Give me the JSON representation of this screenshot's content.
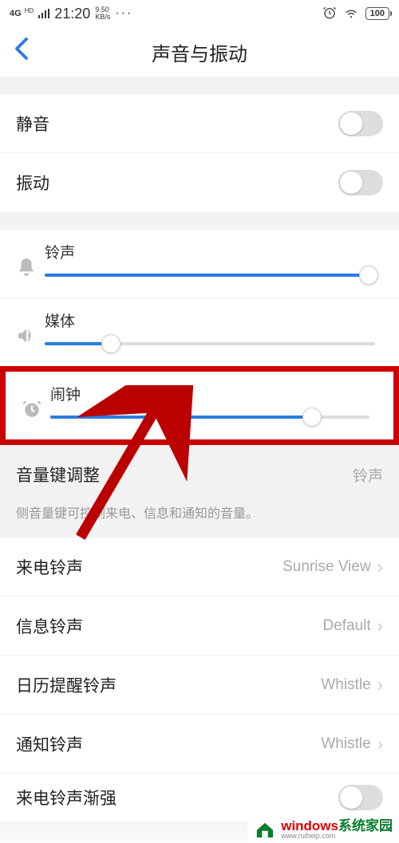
{
  "status": {
    "network": "4G",
    "hd": "HD",
    "time": "21:20",
    "speed_val": "9.50",
    "speed_unit": "KB/s",
    "battery": "100"
  },
  "header": {
    "title": "声音与振动"
  },
  "toggles": {
    "mute_label": "静音",
    "vibrate_label": "振动"
  },
  "sliders": {
    "ringtone": {
      "label": "铃声",
      "percent": 98
    },
    "media": {
      "label": "媒体",
      "percent": 20
    },
    "alarm": {
      "label": "闹钟",
      "percent": 82
    }
  },
  "volkey": {
    "label": "音量键调整",
    "value": "铃声",
    "desc": "侧音量键可控制来电、信息和通知的音量。"
  },
  "ringtones": {
    "incoming": {
      "label": "来电铃声",
      "value": "Sunrise View"
    },
    "message": {
      "label": "信息铃声",
      "value": "Default"
    },
    "calendar": {
      "label": "日历提醒铃声",
      "value": "Whistle"
    },
    "notification": {
      "label": "通知铃声",
      "value": "Whistle"
    },
    "crescendo": {
      "label": "来电铃声渐强"
    }
  },
  "watermark": {
    "brand1": "windows",
    "brand2": "系统家园",
    "url": "www.ruiheip.com"
  }
}
